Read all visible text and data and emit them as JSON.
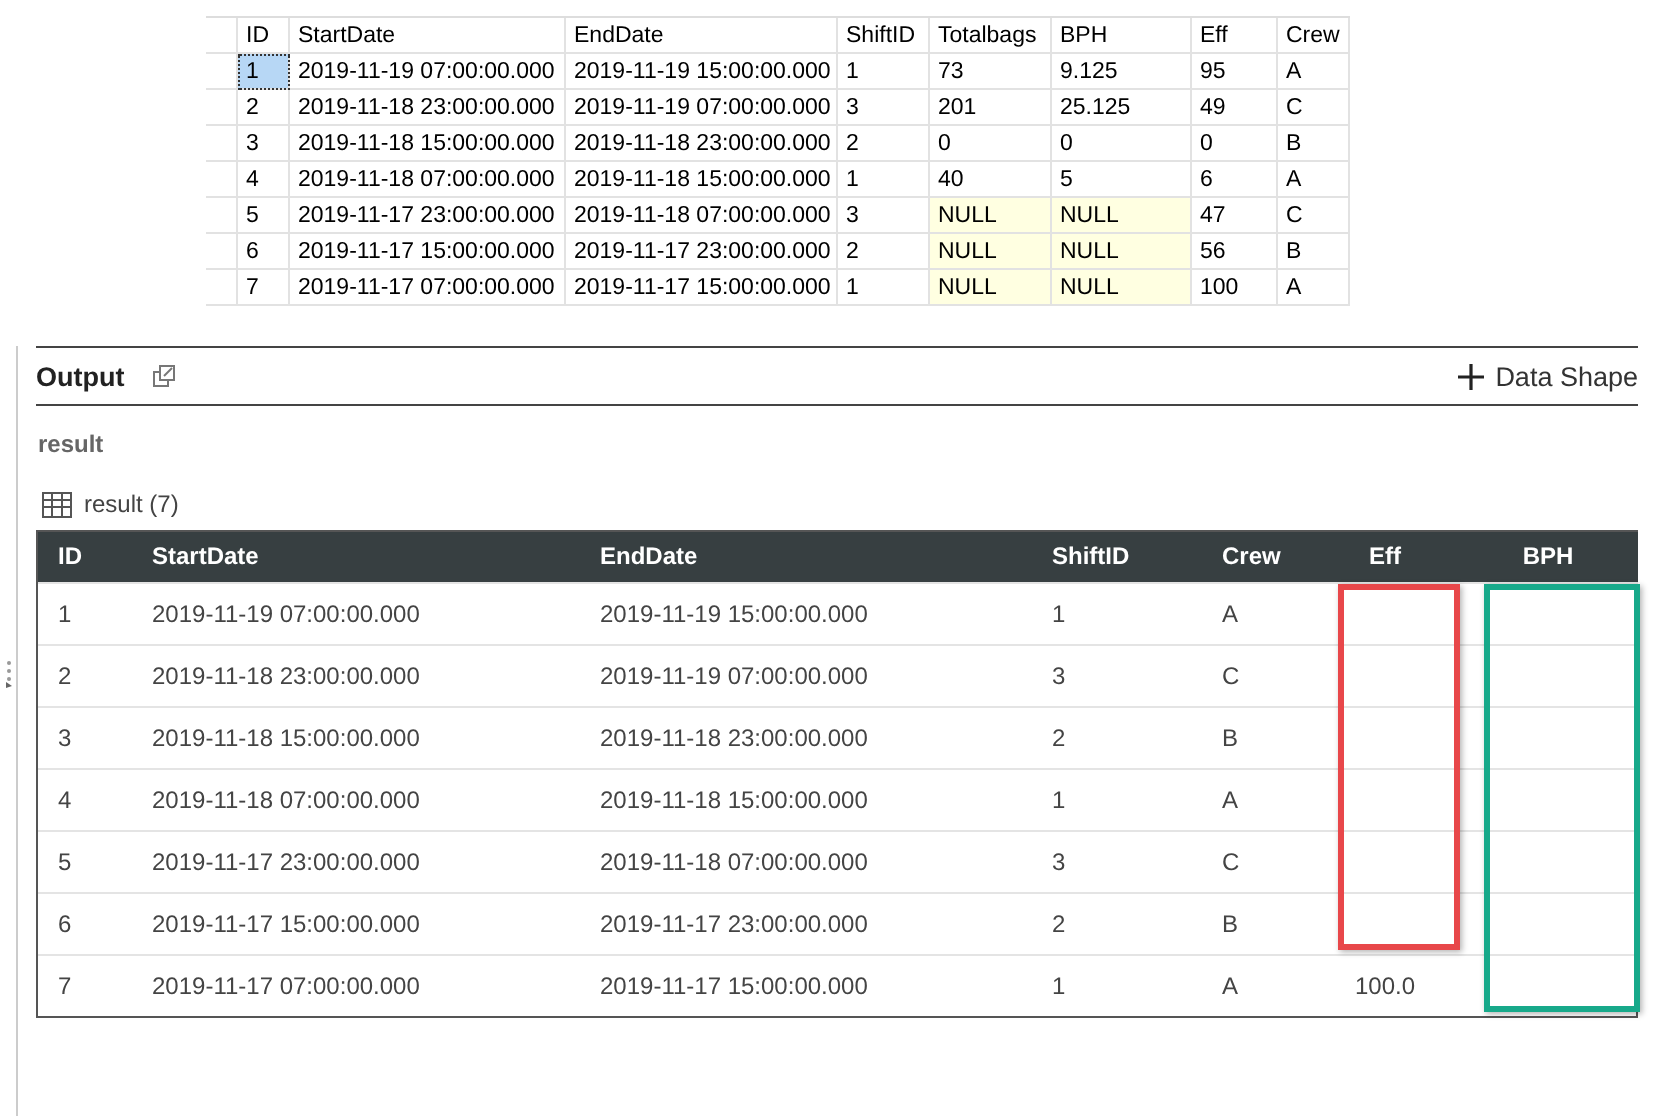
{
  "query_grid": {
    "columns": [
      "ID",
      "StartDate",
      "EndDate",
      "ShiftID",
      "Totalbags",
      "BPH",
      "Eff",
      "Crew"
    ],
    "rows": [
      {
        "selected": true,
        "cells": [
          {
            "text": "1",
            "null": false
          },
          {
            "text": "2019-11-19 07:00:00.000",
            "null": false
          },
          {
            "text": "2019-11-19 15:00:00.000",
            "null": false
          },
          {
            "text": "1",
            "null": false
          },
          {
            "text": "73",
            "null": false
          },
          {
            "text": "9.125",
            "null": false
          },
          {
            "text": "95",
            "null": false
          },
          {
            "text": "A",
            "null": false
          }
        ]
      },
      {
        "selected": false,
        "cells": [
          {
            "text": "2",
            "null": false
          },
          {
            "text": "2019-11-18 23:00:00.000",
            "null": false
          },
          {
            "text": "2019-11-19 07:00:00.000",
            "null": false
          },
          {
            "text": "3",
            "null": false
          },
          {
            "text": "201",
            "null": false
          },
          {
            "text": "25.125",
            "null": false
          },
          {
            "text": "49",
            "null": false
          },
          {
            "text": "C",
            "null": false
          }
        ]
      },
      {
        "selected": false,
        "cells": [
          {
            "text": "3",
            "null": false
          },
          {
            "text": "2019-11-18 15:00:00.000",
            "null": false
          },
          {
            "text": "2019-11-18 23:00:00.000",
            "null": false
          },
          {
            "text": "2",
            "null": false
          },
          {
            "text": "0",
            "null": false
          },
          {
            "text": "0",
            "null": false
          },
          {
            "text": "0",
            "null": false
          },
          {
            "text": "B",
            "null": false
          }
        ]
      },
      {
        "selected": false,
        "cells": [
          {
            "text": "4",
            "null": false
          },
          {
            "text": "2019-11-18 07:00:00.000",
            "null": false
          },
          {
            "text": "2019-11-18 15:00:00.000",
            "null": false
          },
          {
            "text": "1",
            "null": false
          },
          {
            "text": "40",
            "null": false
          },
          {
            "text": "5",
            "null": false
          },
          {
            "text": "6",
            "null": false
          },
          {
            "text": "A",
            "null": false
          }
        ]
      },
      {
        "selected": false,
        "cells": [
          {
            "text": "5",
            "null": false
          },
          {
            "text": "2019-11-17 23:00:00.000",
            "null": false
          },
          {
            "text": "2019-11-18 07:00:00.000",
            "null": false
          },
          {
            "text": "3",
            "null": false
          },
          {
            "text": "NULL",
            "null": true
          },
          {
            "text": "NULL",
            "null": true
          },
          {
            "text": "47",
            "null": false
          },
          {
            "text": "C",
            "null": false
          }
        ]
      },
      {
        "selected": false,
        "cells": [
          {
            "text": "6",
            "null": false
          },
          {
            "text": "2019-11-17 15:00:00.000",
            "null": false
          },
          {
            "text": "2019-11-17 23:00:00.000",
            "null": false
          },
          {
            "text": "2",
            "null": false
          },
          {
            "text": "NULL",
            "null": true
          },
          {
            "text": "NULL",
            "null": true
          },
          {
            "text": "56",
            "null": false
          },
          {
            "text": "B",
            "null": false
          }
        ]
      },
      {
        "selected": false,
        "cells": [
          {
            "text": "7",
            "null": false
          },
          {
            "text": "2019-11-17 07:00:00.000",
            "null": false
          },
          {
            "text": "2019-11-17 15:00:00.000",
            "null": false
          },
          {
            "text": "1",
            "null": false
          },
          {
            "text": "NULL",
            "null": true
          },
          {
            "text": "NULL",
            "null": true
          },
          {
            "text": "100",
            "null": false
          },
          {
            "text": "A",
            "null": false
          }
        ]
      }
    ]
  },
  "output": {
    "title": "Output",
    "action": "Data Shape",
    "section": "result",
    "table_label": "result (7)",
    "columns": [
      {
        "label": "ID"
      },
      {
        "label": "StartDate"
      },
      {
        "label": "EndDate"
      },
      {
        "label": "ShiftID"
      },
      {
        "label": "Crew"
      },
      {
        "label": "Eff",
        "color": "#e8474a"
      },
      {
        "label": "BPH",
        "color": "#17a98a"
      }
    ],
    "rows": [
      [
        "1",
        "2019-11-19 07:00:00.000",
        "2019-11-19 15:00:00.000",
        "1",
        "A",
        "",
        ""
      ],
      [
        "2",
        "2019-11-18 23:00:00.000",
        "2019-11-19 07:00:00.000",
        "3",
        "C",
        "",
        ""
      ],
      [
        "3",
        "2019-11-18 15:00:00.000",
        "2019-11-18 23:00:00.000",
        "2",
        "B",
        "",
        ""
      ],
      [
        "4",
        "2019-11-18 07:00:00.000",
        "2019-11-18 15:00:00.000",
        "1",
        "A",
        "",
        ""
      ],
      [
        "5",
        "2019-11-17 23:00:00.000",
        "2019-11-18 07:00:00.000",
        "3",
        "C",
        "",
        ""
      ],
      [
        "6",
        "2019-11-17 15:00:00.000",
        "2019-11-17 23:00:00.000",
        "2",
        "B",
        "",
        ""
      ],
      [
        "7",
        "2019-11-17 07:00:00.000",
        "2019-11-17 15:00:00.000",
        "1",
        "A",
        "100.0",
        ""
      ]
    ]
  }
}
